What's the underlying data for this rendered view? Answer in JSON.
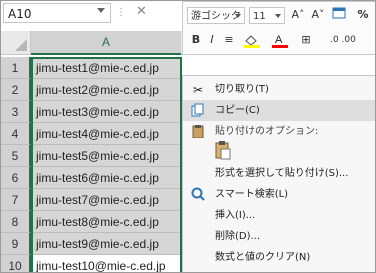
{
  "formula_bar": {
    "name_box": "A10",
    "cancel_glyph": "✕"
  },
  "grid": {
    "column_header": "A",
    "rows": [
      {
        "num": "1",
        "value": "jimu-test1@mie-c.ed.jp"
      },
      {
        "num": "2",
        "value": "jimu-test2@mie-c.ed.jp"
      },
      {
        "num": "3",
        "value": "jimu-test3@mie-c.ed.jp"
      },
      {
        "num": "4",
        "value": "jimu-test4@mie-c.ed.jp"
      },
      {
        "num": "5",
        "value": "jimu-test5@mie-c.ed.jp"
      },
      {
        "num": "6",
        "value": "jimu-test6@mie-c.ed.jp"
      },
      {
        "num": "7",
        "value": "jimu-test7@mie-c.ed.jp"
      },
      {
        "num": "8",
        "value": "jimu-test8@mie-c.ed.jp"
      },
      {
        "num": "9",
        "value": "jimu-test9@mie-c.ed.jp"
      },
      {
        "num": "10",
        "value": "jimu-test10@mie-c.ed.jp"
      }
    ],
    "active_row_index": 9,
    "selection_color": "#217346"
  },
  "mini_toolbar": {
    "font_name": "游ゴシック",
    "font_size": "11",
    "grow_font": "A˄",
    "shrink_font": "A˅",
    "percent": "%",
    "bold": "B",
    "italic": "I",
    "align": "≡",
    "fill_color": "#ffff00",
    "font_color": "#ff0000",
    "borders": "⊞",
    "decimal": ".0 .00"
  },
  "context_menu": {
    "items": [
      {
        "icon": "scissors-icon",
        "label": "切り取り(T)",
        "highlight": false
      },
      {
        "icon": "copy-icon",
        "label": "コピー(C)",
        "highlight": true
      },
      {
        "icon": "clipboard-icon",
        "label": "貼り付けのオプション:",
        "highlight": false
      },
      {
        "icon": "",
        "label": "形式を選択して貼り付け(S)...",
        "highlight": false
      },
      {
        "icon": "smart-search-icon",
        "label": "スマート検索(L)",
        "highlight": false
      },
      {
        "icon": "",
        "label": "挿入(I)...",
        "highlight": false
      },
      {
        "icon": "",
        "label": "削除(D)...",
        "highlight": false
      },
      {
        "icon": "",
        "label": "数式と値のクリア(N)",
        "highlight": false
      }
    ]
  }
}
